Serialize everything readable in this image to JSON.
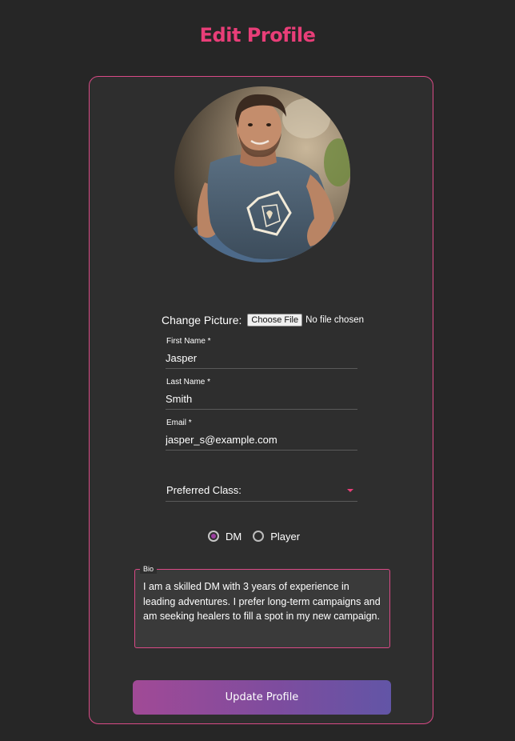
{
  "page": {
    "title": "Edit Profile"
  },
  "avatar": {
    "icon": "profile-photo"
  },
  "picture": {
    "label": "Change Picture:",
    "button_label": "Choose File",
    "file_status": "No file chosen"
  },
  "fields": {
    "first_name": {
      "label": "First Name *",
      "value": "Jasper"
    },
    "last_name": {
      "label": "Last Name *",
      "value": "Smith"
    },
    "email": {
      "label": "Email *",
      "value": "jasper_s@example.com"
    }
  },
  "preferred_class": {
    "label": "Preferred Class:",
    "icon": "caret-down-icon"
  },
  "role": {
    "options": [
      "DM",
      "Player"
    ],
    "selected": "DM"
  },
  "bio": {
    "label": "Bio",
    "text": "I am a skilled DM with 3 years of experience in leading adventures. I prefer long-term campaigns and am seeking healers to fill a spot in my new campaign."
  },
  "actions": {
    "update_label": "Update Profile"
  },
  "colors": {
    "accent": "#e83e78",
    "background": "#262626",
    "card": "#2e2e2e",
    "button_gradient_start": "#a14a96",
    "button_gradient_end": "#6255a6",
    "radio_selected": "#9b3fa0"
  }
}
